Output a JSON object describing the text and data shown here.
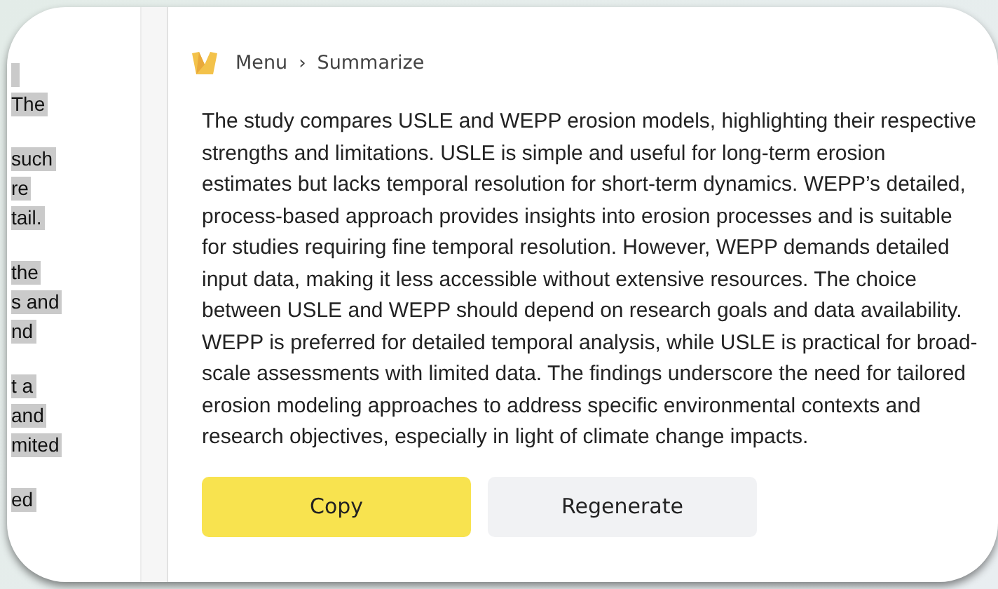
{
  "side_text": {
    "paragraphs": [
      [
        "The"
      ],
      [
        "such",
        "re",
        "tail."
      ],
      [
        "the",
        "s and",
        "nd"
      ],
      [
        "t a",
        "and",
        "mited"
      ],
      [
        "ed"
      ]
    ]
  },
  "breadcrumb": [
    {
      "label": "Menu"
    },
    {
      "label": "Summarize"
    }
  ],
  "breadcrumb_separator": "›",
  "summary": "The study compares USLE and WEPP erosion models, highlighting their respective strengths and limitations. USLE is simple and useful for long-term erosion estimates but lacks temporal resolution for short-term dynamics. WEPP’s detailed, process-based approach provides insights into erosion processes and is suitable for studies requiring fine temporal resolution. However, WEPP demands detailed input data, making it less accessible without extensive resources. The choice between USLE and WEPP should depend on research goals and data availability. WEPP is preferred for detailed temporal analysis, while USLE is practical for broad-scale assessments with limited data. The findings underscore the need for tailored erosion modeling approaches to address specific environmental contexts and research objectives, especially in light of climate change impacts.",
  "buttons": [
    {
      "label": "Copy",
      "kind": "primary"
    },
    {
      "label": "Regenerate",
      "kind": "secondary"
    }
  ]
}
